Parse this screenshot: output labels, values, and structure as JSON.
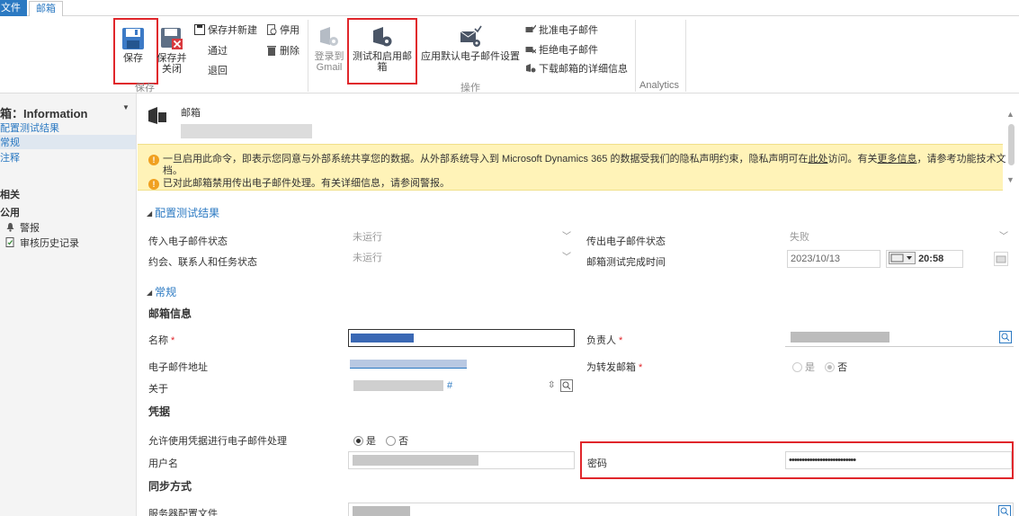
{
  "tabs": {
    "file": "文件",
    "mailbox": "邮箱"
  },
  "ribbon": {
    "save": "保存",
    "save_close_line1": "保存并",
    "save_close_line2": "关闭",
    "save_new": "保存并新建",
    "approve": "通过",
    "reject": "退回",
    "deactivate": "停用",
    "delete": "删除",
    "group_save": "保存",
    "login_gmail_line1": "登录到",
    "login_gmail_line2": "Gmail",
    "test_enable": "测试和启用邮箱",
    "apply_default": "应用默认电子邮件设置",
    "approve_email": "批准电子邮件",
    "reject_email": "拒绝电子邮件",
    "download_details": "下载邮箱的详细信息",
    "group_actions": "操作",
    "group_analytics": "Analytics"
  },
  "nav": {
    "title": "箱：Information",
    "items": [
      "配置测试结果",
      "常规",
      "注释"
    ],
    "related_head": "相关",
    "common_head": "公用",
    "common_items": [
      "警报",
      "审核历史记录"
    ]
  },
  "record": {
    "type_label": "邮箱"
  },
  "notice": {
    "line1_a": "一旦启用此命令，即表示您同意与外部系统共享您的数据。从外部系统导入到 Microsoft Dynamics 365 的数据受我们的隐私声明约束，隐私声明可在",
    "line1_link1": "此处",
    "line1_b": "访问。有关",
    "line1_link2": "更多信息",
    "line1_c": "，请参考功能技术文",
    "line1_wrap": "档。",
    "line2": "已对此邮箱禁用传出电子邮件处理。有关详细信息，请参阅警报。"
  },
  "sections": {
    "test_results": {
      "title": "配置测试结果",
      "incoming_label": "传入电子邮件状态",
      "incoming_value": "未运行",
      "outgoing_label": "传出电子邮件状态",
      "outgoing_value": "失败",
      "appt_label": "约会、联系人和任务状态",
      "appt_value": "未运行",
      "test_time_label": "邮箱测试完成时间",
      "test_date": "2023/10/13",
      "test_time": "20:58"
    },
    "general": {
      "title": "常规",
      "mailbox_info": "邮箱信息",
      "name_label": "名称",
      "owner_label": "负责人",
      "email_label": "电子邮件地址",
      "forward_label": "为转发邮箱",
      "forward_yes": "是",
      "forward_no": "否",
      "regarding_label": "关于",
      "regarding_suffix": "#",
      "credentials": "凭据",
      "allow_cred_label": "允许使用凭据进行电子邮件处理",
      "allow_yes": "是",
      "allow_no": "否",
      "username_label": "用户名",
      "password_label": "密码",
      "password_value": "••••••••••••••••••••••••••",
      "sync_method": "同步方式",
      "server_profile_label": "服务器配置文件"
    }
  },
  "colors": {
    "accent": "#2b79c2",
    "highlight_box": "#e0262b",
    "notice_bg": "#fff3b8"
  }
}
